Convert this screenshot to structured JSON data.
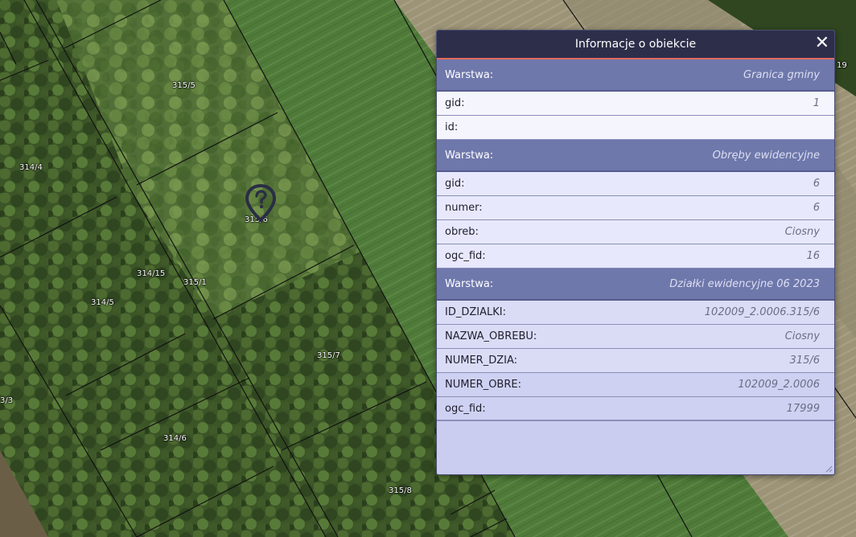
{
  "map": {
    "parcel_labels": [
      {
        "text": "315/5"
      },
      {
        "text": "314/4"
      },
      {
        "text": "315/6"
      },
      {
        "text": "314/15"
      },
      {
        "text": "315/1"
      },
      {
        "text": "314/5"
      },
      {
        "text": "315/7"
      },
      {
        "text": "3/3"
      },
      {
        "text": "314/6"
      },
      {
        "text": "315/8"
      },
      {
        "text": "19"
      }
    ],
    "marker_icon": "question-map-pin-icon"
  },
  "popup": {
    "title": "Informacje o obiekcie",
    "close_label": "✕",
    "close_icon": "close-icon",
    "sections": [
      {
        "layer_label": "Warstwa:",
        "layer_name": "Granica gminy",
        "fields": [
          {
            "key": "gid:",
            "value": "1"
          },
          {
            "key": "id:",
            "value": ""
          }
        ]
      },
      {
        "layer_label": "Warstwa:",
        "layer_name": "Obręby ewidencyjne",
        "fields": [
          {
            "key": "gid:",
            "value": "6"
          },
          {
            "key": "numer:",
            "value": "6"
          },
          {
            "key": "obreb:",
            "value": "Ciosny"
          },
          {
            "key": "ogc_fid:",
            "value": "16"
          }
        ]
      },
      {
        "layer_label": "Warstwa:",
        "layer_name": "Działki ewidencyjne 06 2023",
        "fields": [
          {
            "key": "ID_DZIALKI:",
            "value": "102009_2.0006.315/6"
          },
          {
            "key": "NAZWA_OBREBU:",
            "value": "Ciosny"
          },
          {
            "key": "NUMER_DZIA:",
            "value": "315/6"
          },
          {
            "key": "NUMER_OBRE:",
            "value": "102009_2.0006"
          },
          {
            "key": "ogc_fid:",
            "value": "17999"
          }
        ]
      }
    ]
  },
  "colors": {
    "header_bg": "#2d2f4a",
    "header_accent": "#e06a5b",
    "layer_row_bg": "#6f78ab",
    "popup_bg": "#cbcdf0"
  }
}
